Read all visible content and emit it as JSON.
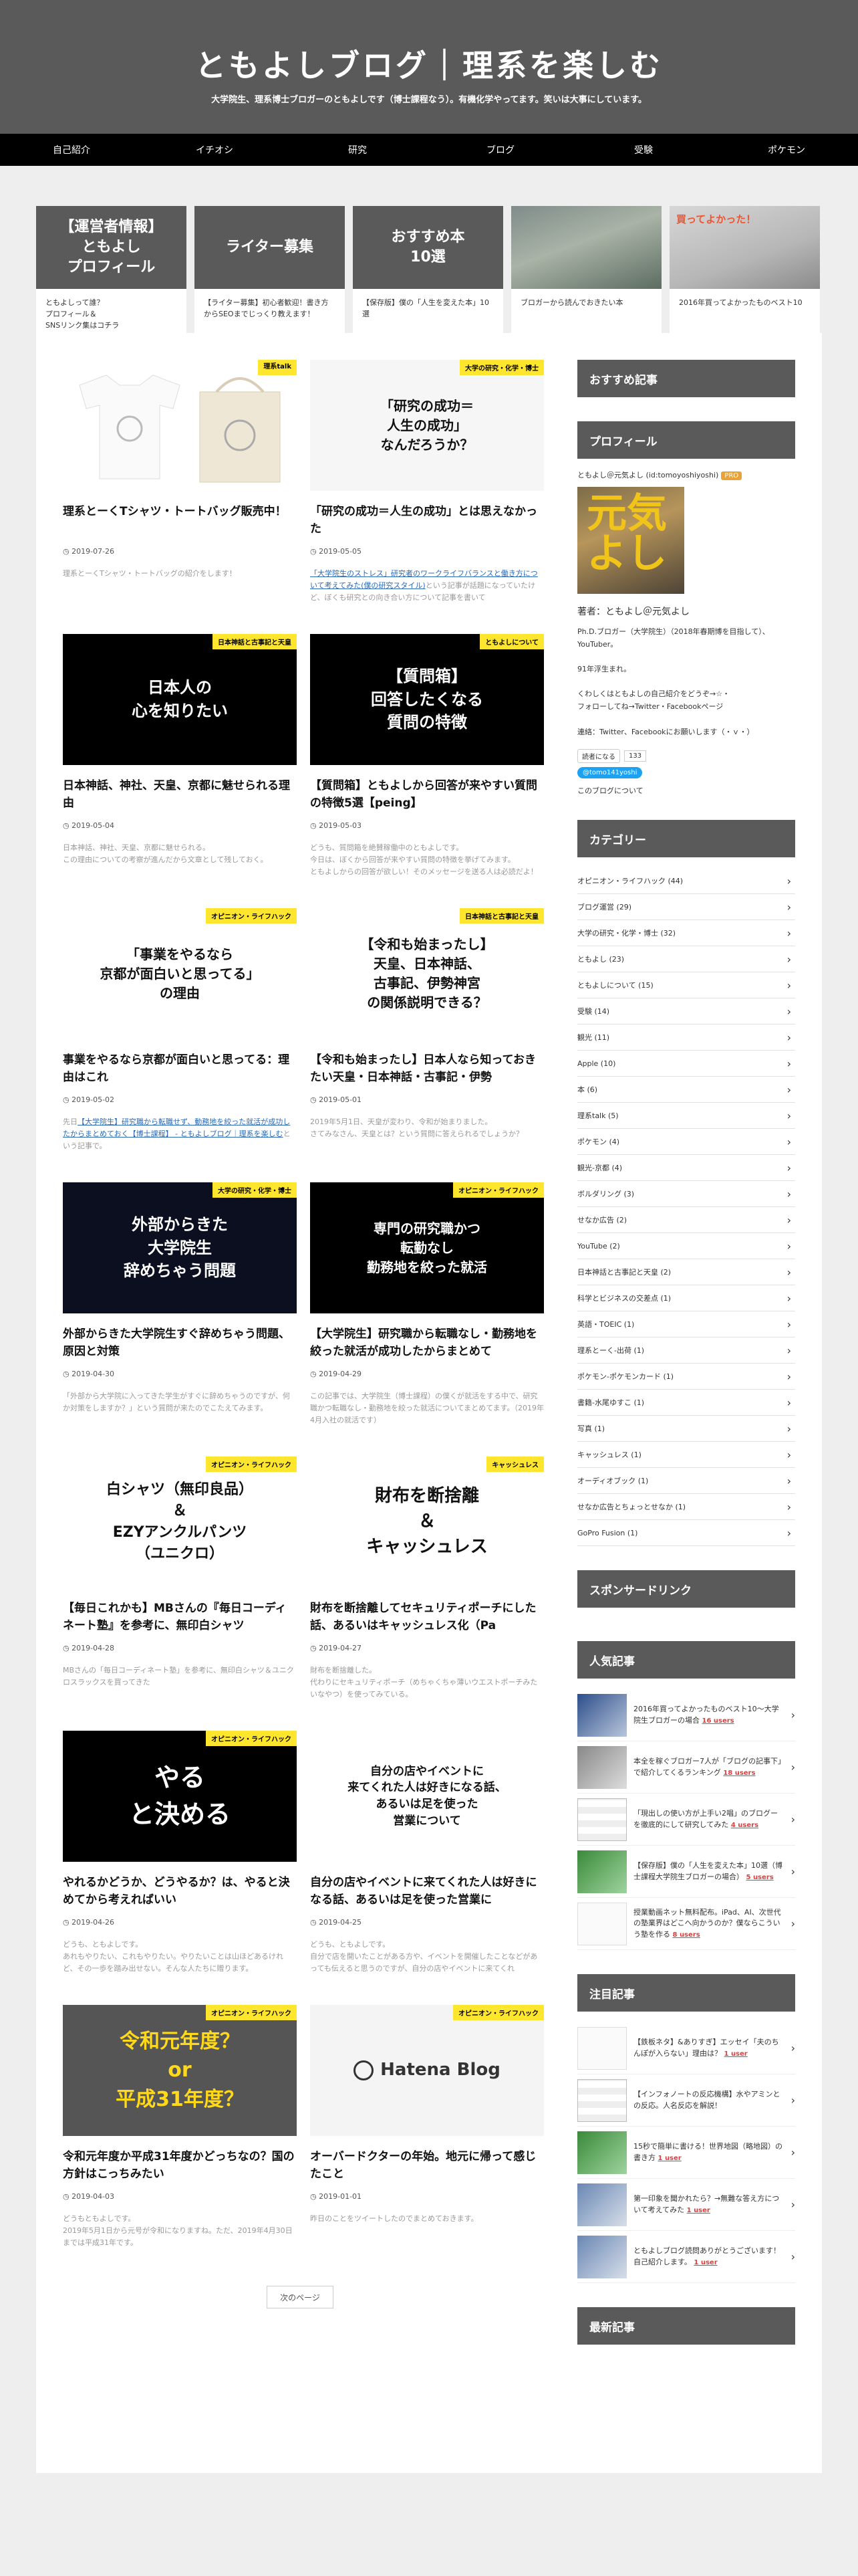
{
  "site": {
    "title": "ともよしブログ｜理系を楽しむ",
    "description": "大学院生、理系博士ブロガーのともよしです（博士課程なう）。有機化学やってます。笑いは大事にしています。"
  },
  "nav": [
    "自己紹介",
    "イチオシ",
    "研究",
    "ブログ",
    "受験",
    "ポケモン"
  ],
  "carousel": [
    {
      "img_text": "【運営者情報】\nともよし\nプロフィール",
      "caption": "ともよしって誰？\nプロフィール＆\nSNSリンク集はコチラ"
    },
    {
      "img_text": "ライター募集",
      "caption": "【ライター募集】初心者歓迎！書き方からSEOまでじっくり教えます！"
    },
    {
      "img_text": "おすすめ本\n10選",
      "caption": "【保存版】僕の「人生を変えた本」10選"
    },
    {
      "img_text": "",
      "caption": "ブロガーから読んでおきたい本"
    },
    {
      "img_text": "買ってよかった！",
      "caption": "2016年買ってよかったものベスト10"
    }
  ],
  "posts": [
    {
      "tag": "理系talk",
      "thumb": "",
      "title": "理系とーくTシャツ・トートバッグ販売中！",
      "date": "2019-07-26",
      "excerpt": "理系とーくTシャツ・トートバッグの紹介をします！"
    },
    {
      "tag": "大学の研究・化学・博士",
      "thumb": "「研究の成功＝\n人生の成功」\nなんだろうか？",
      "title": "「研究の成功＝人生の成功」とは思えなかった",
      "date": "2019-05-05",
      "excerpt_link": "「大学院生のストレス」研究者のワークライフバランスと働き方について考えてみた(僕の研究スタイル)",
      "excerpt": "という記事が話題になっていたけど、ぼくも研究との向き合い方について記事を書いて"
    },
    {
      "tag": "日本神話と古事記と天皇",
      "thumb": "日本人の\n心を知りたい",
      "title": "日本神話、神社、天皇、京都に魅せられる理由",
      "date": "2019-05-04",
      "excerpt": "日本神話、神社、天皇、京都に魅せられる。\nこの理由についての考察が進んだから文章として残しておく。"
    },
    {
      "tag": "ともよしについて",
      "thumb": "【質問箱】\n回答したくなる\n質問の特徴",
      "title": "【質問箱】ともよしから回答が来やすい質問の特徴5選【peing】",
      "date": "2019-05-03",
      "excerpt": "どうも、質問箱を絶賛稼働中のともよしです。\n今日は、ぼくから回答が来やすい質問の特徴を挙げてみます。\nともよしからの回答が欲しい！そのメッセージを送る人は必読だよ！"
    },
    {
      "tag": "オピニオン・ライフハック",
      "thumb": "「事業をやるなら\n京都が面白いと思ってる」\nの理由",
      "title": "事業をやるなら京都が面白いと思ってる：理由はこれ",
      "date": "2019-05-02",
      "excerpt_link": "【大学院生】研究職から転職せず、動務地を絞った就活が成功したからまとめておく【博士課程】 - ともよしブログ｜理系を楽しむ",
      "excerpt": "という記事で。"
    },
    {
      "tag": "日本神話と古事記と天皇",
      "thumb": "【令和も始まったし】\n天皇、日本神話、\n古事記、伊勢神宮\nの関係説明できる？",
      "title": "【令和も始まったし】日本人なら知っておきたい天皇・日本神話・古事記・伊勢",
      "date": "2019-05-01",
      "excerpt": "2019年5月1日、天皇が変わり、令和が始まりました。\nさてみなさん、天皇とは？という質問に答えられるでしょうか？"
    },
    {
      "tag": "大学の研究・化学・博士",
      "thumb": "外部からきた\n大学院生\n辞めちゃう問題",
      "title": "外部からきた大学院生すぐ辞めちゃう問題、原因と対策",
      "date": "2019-04-30",
      "excerpt": "「外部から大学院に入ってきた学生がすぐに辞めちゃうのですが、何か対策をしますか？」という質問が来たのでこたえてみます。"
    },
    {
      "tag": "オピニオン・ライフハック",
      "thumb": "専門の研究職かつ\n転勤なし\n勤務地を絞った就活",
      "title": "【大学院生】研究職から転職なし・勤務地を絞った就活が成功したからまとめて",
      "date": "2019-04-29",
      "excerpt": "この記事では、大学院生（博士課程）の僕くが就活をする中で、研究職かつ転職なし・勤務地を絞った就活についてまとめてます。（2019年4月入社の就活です）"
    },
    {
      "tag": "オピニオン・ライフハック",
      "thumb": "白シャツ（無印良品）\n＆\nEZYアンクルパンツ\n（ユニクロ）",
      "title": "【毎日これかも】MBさんの『毎日コーディネート塾』を参考に、無印白シャツ",
      "date": "2019-04-28",
      "excerpt": "MBさんの「毎日コーディネート塾」を参考に、無印白シャツ＆ユニクロスラックスを買ってきた"
    },
    {
      "tag": "キャッシュレス",
      "thumb": "財布を断捨離\n＆\nキャッシュレス",
      "title": "財布を断捨離してセキュリティポーチにした話、あるいはキャッシュレス化（Pa",
      "date": "2019-04-27",
      "excerpt": "財布を断捨離した。\n代わりにセキュリティポーチ（めちゃくちゃ薄いウエストポーチみたいなやつ）を使ってみている。"
    },
    {
      "tag": "オピニオン・ライフハック",
      "thumb": "やる\nと決める",
      "title": "やれるかどうか、どうやるか？は、やると決めてから考えればいい",
      "date": "2019-04-26",
      "excerpt": "どうも、ともよしです。\nあれもやりたい、これもやりたい。やりたいことは山ほどあるけれど、その一歩を踏み出せない。そんな人たちに贈ります。"
    },
    {
      "tag": "",
      "thumb": "自分の店やイベントに\n来てくれた人は好きになる話、\nあるいは足を使った\n営業について",
      "title": "自分の店やイベントに来てくれた人は好きになる話、あるいは足を使った営業に",
      "date": "2019-04-25",
      "excerpt": "どうも、ともよしです。\n自分で店を開いたことがある方や、イベントを開催したことなどがあっても伝えると思うのですが、自分の店やイベントに来てくれ"
    },
    {
      "tag": "オピニオン・ライフハック",
      "thumb": "令和元年度？\nor\n平成31年度？",
      "title": "令和元年度か平成31年度かどっちなの？国の方針はこっちみたい",
      "date": "2019-04-03",
      "excerpt": "どうもともよしです。\n2019年5月1日から元号が令和になりますね。ただ、2019年4月30日までは平成31年です。"
    },
    {
      "tag": "オピニオン・ライフハック",
      "thumb": "Hatena Blog",
      "title": "オーバードクターの年始。地元に帰って感じたこと",
      "date": "2019-01-01",
      "excerpt": "昨日のことをツイートしたのでまとめておきます。"
    }
  ],
  "pagination": {
    "next_label": "次のページ"
  },
  "sidebar": {
    "recommended_heading": "おすすめ記事",
    "profile_heading": "プロフィール",
    "profile_id": "ともよし＠元気よし (id:tomoyoshiyoshi)",
    "profile_pro": "PRO",
    "profile_photo_text": "元気\nよし",
    "profile_author": "著者：ともよし＠元気よし",
    "profile_text": "Ph.D.ブロガー（大学院生）（2018年春期博を目指して）、YouTuber。\n\n91年浮生まれ。\n\nくわしくはともよしの自己紹介をどうぞ→☆・\nフォローしてね→Twitter・Facebookページ\n\n連絡：Twitter、Facebookにお願いします（・ｖ・）",
    "reader_label": "読者になる",
    "reader_count": "133",
    "twitter_label": "@tomo141yoshi",
    "about_link": "このブログについて",
    "category_heading": "カテゴリー",
    "categories": [
      "オピニオン・ライフハック (44)",
      "ブログ運営 (29)",
      "大学の研究・化学・博士 (32)",
      "ともよし (23)",
      "ともよしについて (15)",
      "受験 (14)",
      "観光 (11)",
      "Apple (10)",
      "本 (6)",
      "理系talk (5)",
      "ポケモン (4)",
      "観光-京都 (4)",
      "ボルダリング (3)",
      "せなか広告 (2)",
      "YouTube (2)",
      "日本神話と古事記と天皇 (2)",
      "科学とビジネスの交差点 (1)",
      "英語・TOEIC (1)",
      "理系とーく-出荷 (1)",
      "ポケモン-ポケモンカード (1)",
      "書籍-水尾ゆすこ (1)",
      "写真 (1)",
      "キャッシュレス (1)",
      "オーディオブック (1)",
      "せなか広告とちょっとせなか (1)",
      "GoPro Fusion (1)"
    ],
    "sponsored_heading": "スポンサードリンク",
    "popular_heading": "人気記事",
    "popular": [
      {
        "text": "2016年買ってよかったものベスト10〜大学院生ブロガーの場合",
        "users": "16 users"
      },
      {
        "text": "本全を稼ぐブロガー7人が「ブログの記事下」で紹介してくるランキング",
        "users": "18 users"
      },
      {
        "text": "「現出しの使い方が上手い2唱」のブログーを徹底的にして研究してみた",
        "users": "4 users"
      },
      {
        "text": "【保存版】僕の「人生を変えた本」10選（博士課程大学院生ブロガーの場合）",
        "users": "5 users"
      },
      {
        "text": "授業動画ネット無料配布。iPad、AI、次世代の塾業界はどこへ向かうのか？僕ならこういう塾を作る",
        "users": "8 users"
      }
    ],
    "featured_heading": "注目記事",
    "featured": [
      {
        "text": "【鉄板ネタ】&ありすぎ】エッセイ「夫のちんぽが入らない」理由は？",
        "users": "1 user"
      },
      {
        "text": "【インフォノートの反応機構】水やアミンとの反応。人名反応を解説！",
        "users": ""
      },
      {
        "text": "15秒で簡単に書ける！世界地図（略地図）の書き方",
        "users": "1 user"
      },
      {
        "text": "第一印象を聞かれたら？→無難な答え方について考えてみた",
        "users": "1 user"
      },
      {
        "text": "ともよしブログ読問ありがとうございます！自己紹介します。",
        "users": "1 user"
      }
    ],
    "latest_heading": "最新記事"
  },
  "colors": {
    "header_bg": "#5a5a5a",
    "nav_bg": "#000000",
    "tag_bg": "#ffe62e",
    "link": "#2a6ab8",
    "users": "#e23c3c"
  }
}
